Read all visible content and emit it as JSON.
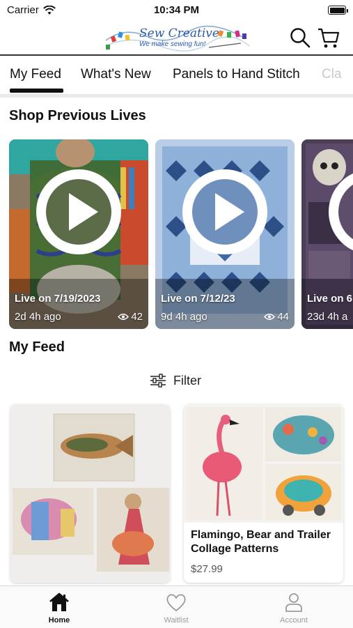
{
  "status_bar": {
    "carrier": "Carrier",
    "time": "10:34 PM"
  },
  "header": {
    "logo_title": "Sew Creative",
    "logo_tagline": "We make sewing fun!",
    "search_icon": "search-icon",
    "cart_icon": "cart-icon"
  },
  "tabs": [
    {
      "label": "My Feed",
      "selected": true
    },
    {
      "label": "What's New"
    },
    {
      "label": "Panels to Hand Stitch"
    },
    {
      "label": "Cla"
    }
  ],
  "lives_section": {
    "title": "Shop Previous Lives",
    "items": [
      {
        "label": "Live on 7/19/2023",
        "ago": "2d 4h ago",
        "views": "42"
      },
      {
        "label": "Live on 7/12/23",
        "ago": "9d 4h ago",
        "views": "44"
      },
      {
        "label": "Live on 6",
        "ago": "23d 4h a",
        "views": ""
      }
    ]
  },
  "feed": {
    "title": "My Feed",
    "filter_label": "Filter",
    "items": [
      {
        "title": "",
        "price": ""
      },
      {
        "title": "Flamingo, Bear and Trailer Collage Patterns",
        "price": "$27.99"
      }
    ]
  },
  "bottom_nav": [
    {
      "label": "Home",
      "icon": "home-icon",
      "active": true
    },
    {
      "label": "Waitlist",
      "icon": "heart-icon"
    },
    {
      "label": "Account",
      "icon": "person-icon"
    }
  ]
}
